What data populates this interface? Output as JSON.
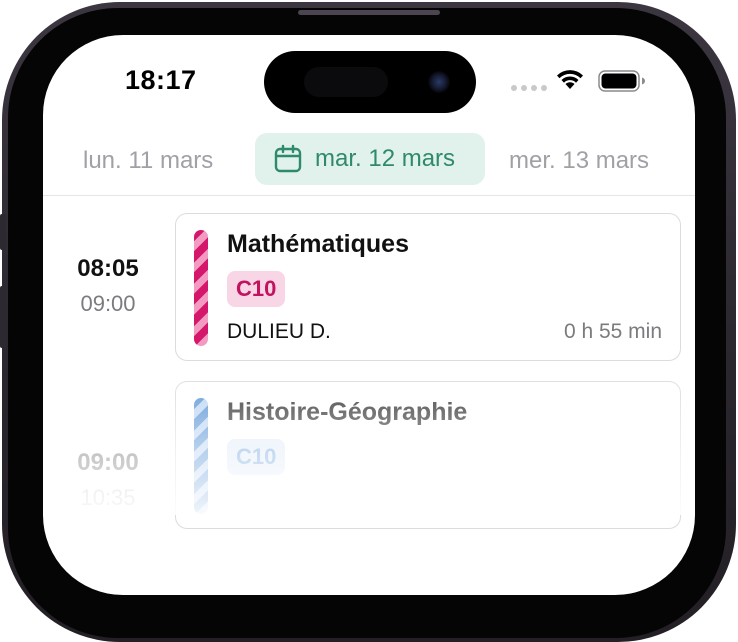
{
  "status_bar": {
    "time": "18:17"
  },
  "day_selector": {
    "previous": "lun. 11 mars",
    "selected": "mar. 12 mars",
    "next": "mer. 13 mars",
    "selected_icon": "calendar-icon"
  },
  "lessons": [
    {
      "start": "08:05",
      "end": "09:00",
      "subject": "Mathématiques",
      "room": "C10",
      "teacher": "DULIEU D.",
      "duration": "0 h 55 min",
      "color": "#d4176b"
    },
    {
      "start": "09:00",
      "end": "10:35",
      "subject": "Histoire-Géographie",
      "room": "C10",
      "color": "#5b95d6"
    }
  ],
  "colors": {
    "accent_green": "#2f8a6a",
    "selected_day_bg": "#e1f1ec",
    "math_pink": "#d4176b",
    "history_blue": "#5b95d6"
  }
}
